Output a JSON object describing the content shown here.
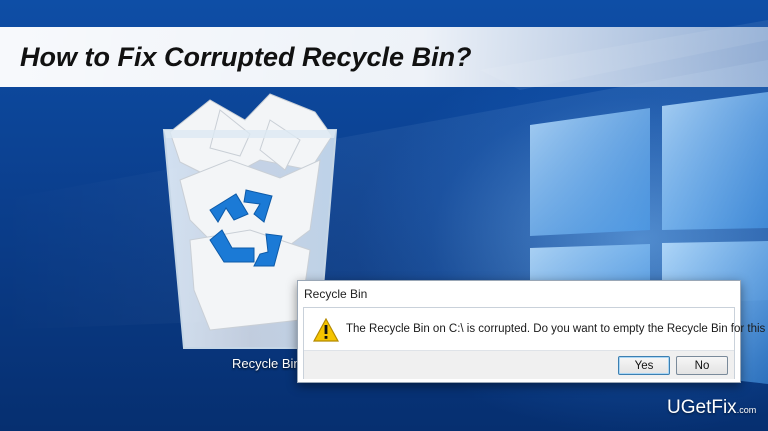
{
  "banner": {
    "title": "How to Fix Corrupted Recycle Bin?"
  },
  "desktop": {
    "wallpaper": "windows-10-logo-wallpaper",
    "colors": {
      "background": "#0b3f8e",
      "light_beam": "#78beff"
    },
    "icons": [
      {
        "label": "Recycle Bin",
        "icon": "recycle-bin-full-icon"
      }
    ]
  },
  "dialog": {
    "title": "Recycle Bin",
    "icon": "warning-icon",
    "message": "The Recycle Bin on C:\\ is corrupted. Do you want to empty the Recycle Bin for this drive?",
    "buttons": {
      "yes": "Yes",
      "no": "No"
    }
  },
  "watermark": {
    "brand": "UGetFix",
    "suffix": ".com"
  }
}
